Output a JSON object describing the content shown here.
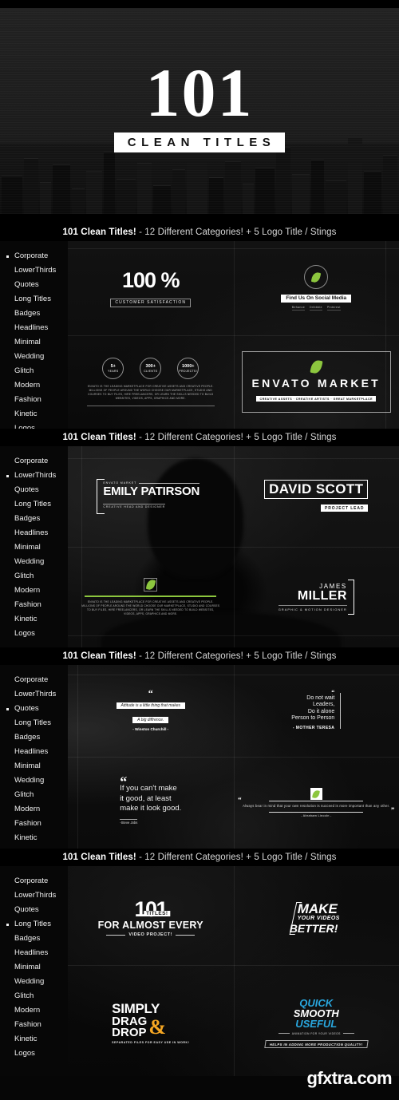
{
  "hero": {
    "number": "101",
    "subtitle": "CLEAN TITLES"
  },
  "banner": {
    "bold": "101 Clean Titles!",
    "rest": " - 12 Different Categories!  + 5 Logo Title / Stings"
  },
  "watermark": "gfxtra.com",
  "colors": {
    "accent_green": "#8cc63e",
    "accent_blue": "#29a7df",
    "accent_orange": "#f5a623",
    "background": "#060606",
    "text": "#ffffff"
  },
  "sidebar": {
    "items": [
      {
        "label": "Corporate"
      },
      {
        "label": "LowerThirds"
      },
      {
        "label": "Quotes"
      },
      {
        "label": "Long Titles"
      },
      {
        "label": "Badges"
      },
      {
        "label": "Headlines"
      },
      {
        "label": "Minimal"
      },
      {
        "label": "Wedding"
      },
      {
        "label": "Glitch"
      },
      {
        "label": "Modern"
      },
      {
        "label": "Fashion"
      },
      {
        "label": "Kinetic"
      },
      {
        "label": "Logos"
      }
    ]
  },
  "sections": [
    {
      "id": "corporate",
      "active_index": 0,
      "cards": {
        "satisfaction": {
          "value": "100 %",
          "label": "CUSTOMER SATISFACTION"
        },
        "social": {
          "pill": "Find Us On Social Media",
          "networks": [
            "Behance",
            "Dribbble",
            "Pinterest"
          ]
        },
        "stats": [
          {
            "number": "5+",
            "label": "YEARS"
          },
          {
            "number": "300+",
            "label": "CLIENTS"
          },
          {
            "number": "1000+",
            "label": "PROJECTS!"
          }
        ],
        "stats_paragraph": "ENVATO IS THE LEADING MARKETPLACE FOR CREATIVE ASSETS AND CREATIVE PEOPLE. MILLIONS OF PEOPLE AROUND THE WORLD CHOOSE OUR MARKETPLACE, STUDIO AND COURSES TO BUY FILES, HIRE FREELANCERS, OR LEARN THE SKILLS NEEDED TO BUILD WEBSITES, VIDEOS, APPS, GRAPHICS AND MORE.",
        "envato": {
          "title": "ENVATO MARKET",
          "subtitle": "CREATIVE ASSETS · CREATIVE ARTISTS · GREAT MARKETPLACE"
        }
      }
    },
    {
      "id": "lowerthirds",
      "active_index": 1,
      "cards": {
        "emily": {
          "kicker": "ENVATO MARKET",
          "name": "EMILY PATIRSON",
          "role": "CREATIVE HEAD AND DESIGNER"
        },
        "david": {
          "name": "DAVID SCOTT",
          "role": "PROJECT LEAD"
        },
        "envato_para": "ENVATO IS THE LEADING MARKETPLACE FOR CREATIVE ASSETS AND CREATIVE PEOPLE. MILLIONS OF PEOPLE AROUND THE WORLD CHOOSE OUR MARKETPLACE, STUDIO AND COURSES TO BUY FILES, HIRE FREELANCERS, OR LEARN THE SKILLS NEEDED TO BUILD WEBSITES, VIDEOS, APPS, GRAPHICS AND MORE.",
        "james": {
          "first": "JAMES",
          "last": "MILLER",
          "role": "GRAPHIC & MOTION DESIGNER"
        }
      }
    },
    {
      "id": "quotes",
      "active_index": 2,
      "cards": {
        "churchill": {
          "quote_mark": "“",
          "line1": "Attitude is a little thing that makes",
          "line2": "A big diffrence.",
          "author": "- Winston Churchill -"
        },
        "teresa": {
          "quote_mark": "“",
          "lines": [
            "Do not wait",
            "Leaders,",
            "Do it alone",
            "Person to Person"
          ],
          "author": "- MOTHER TERESA"
        },
        "jobs": {
          "quote_mark": "“",
          "lines": [
            "If you can't make",
            "it good, at least",
            "make it look good."
          ],
          "author": "-Steve Jobs"
        },
        "lincoln": {
          "quote_mark_left": "“",
          "quote_mark_right": "”",
          "body": "Always bear in mind that your own resolution is succeed is more important than any other.",
          "author": "- Abraham Lincoln -"
        }
      }
    },
    {
      "id": "long-titles",
      "active_index": 3,
      "cards": {
        "titles101": {
          "number": "101",
          "tag": "TITLES!",
          "line2": "FOR ALMOST EVERY",
          "line3": "VIDEO PROJECT!"
        },
        "make": {
          "line1": "MAKE",
          "line2": "YOUR VIDEOS",
          "line3": "BETTER!"
        },
        "dragdrop": {
          "line1": "SIMPLY",
          "line2": "DRAG",
          "line3": "DROP",
          "amp": "&",
          "sub": "SEPARATED FILES FOR EASY USE IN WORK!"
        },
        "quick": {
          "line1": "QUICK",
          "line2": "SMOOTH",
          "line3": "USEFUL",
          "kicker": "ANIMATION FOR YOUR VIDEOS",
          "pill": "HELPS IN ADDING MORE PRODUCTION QUALITY!"
        }
      }
    }
  ]
}
